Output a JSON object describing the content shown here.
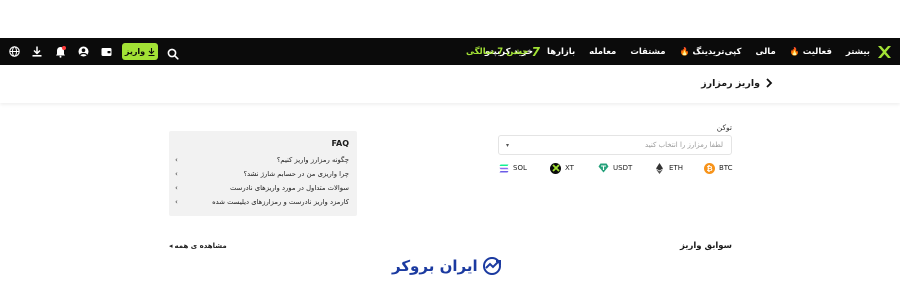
{
  "nav": {
    "items": [
      {
        "label": "خرید کریپتو",
        "fire": false
      },
      {
        "label": "بازارها",
        "fire": false
      },
      {
        "label": "معامله",
        "fire": false
      },
      {
        "label": "مشتقات",
        "fire": false
      },
      {
        "label": "کپی‌تریدینگ",
        "fire": true
      },
      {
        "label": "مالی",
        "fire": false
      },
      {
        "label": "فعالیت",
        "fire": true
      },
      {
        "label": "بیشتر",
        "fire": false
      }
    ],
    "anniversary": "جشن 7 سالگی",
    "anniversary_number": "7",
    "deposit_button": "واریز",
    "colors": {
      "bar": "#0b0b0b",
      "accent": "#a2e235",
      "fire": "#ffb21a"
    }
  },
  "page": {
    "title": "واریز رمزارز"
  },
  "form": {
    "token_label": "توکن",
    "token_placeholder": "لطفا رمزارز را انتخاب کنید",
    "coins": [
      {
        "symbol": "BTC",
        "icon": "btc-icon",
        "color": "#f7931a"
      },
      {
        "symbol": "ETH",
        "icon": "eth-icon",
        "color": "#333333"
      },
      {
        "symbol": "USDT",
        "icon": "usdt-icon",
        "color": "#26a17b"
      },
      {
        "symbol": "XT",
        "icon": "xt-icon",
        "color": "#0b0b0b"
      },
      {
        "symbol": "SOL",
        "icon": "sol-icon",
        "color": "#6c5ce7"
      }
    ]
  },
  "faq": {
    "title": "FAQ",
    "items": [
      "چگونه رمزارز واریز کنیم؟",
      "چرا واریزی من در حسابم شارژ نشد؟",
      "سوالات متداول در مورد واریزهای نادرست",
      "کارمزد واریز نادرست و رمزارزهای دیلیست شده"
    ]
  },
  "history": {
    "title": "سوابق واریز",
    "see_all": "مشاهده ی همه"
  },
  "watermark": {
    "text": "ایران بروکر"
  }
}
